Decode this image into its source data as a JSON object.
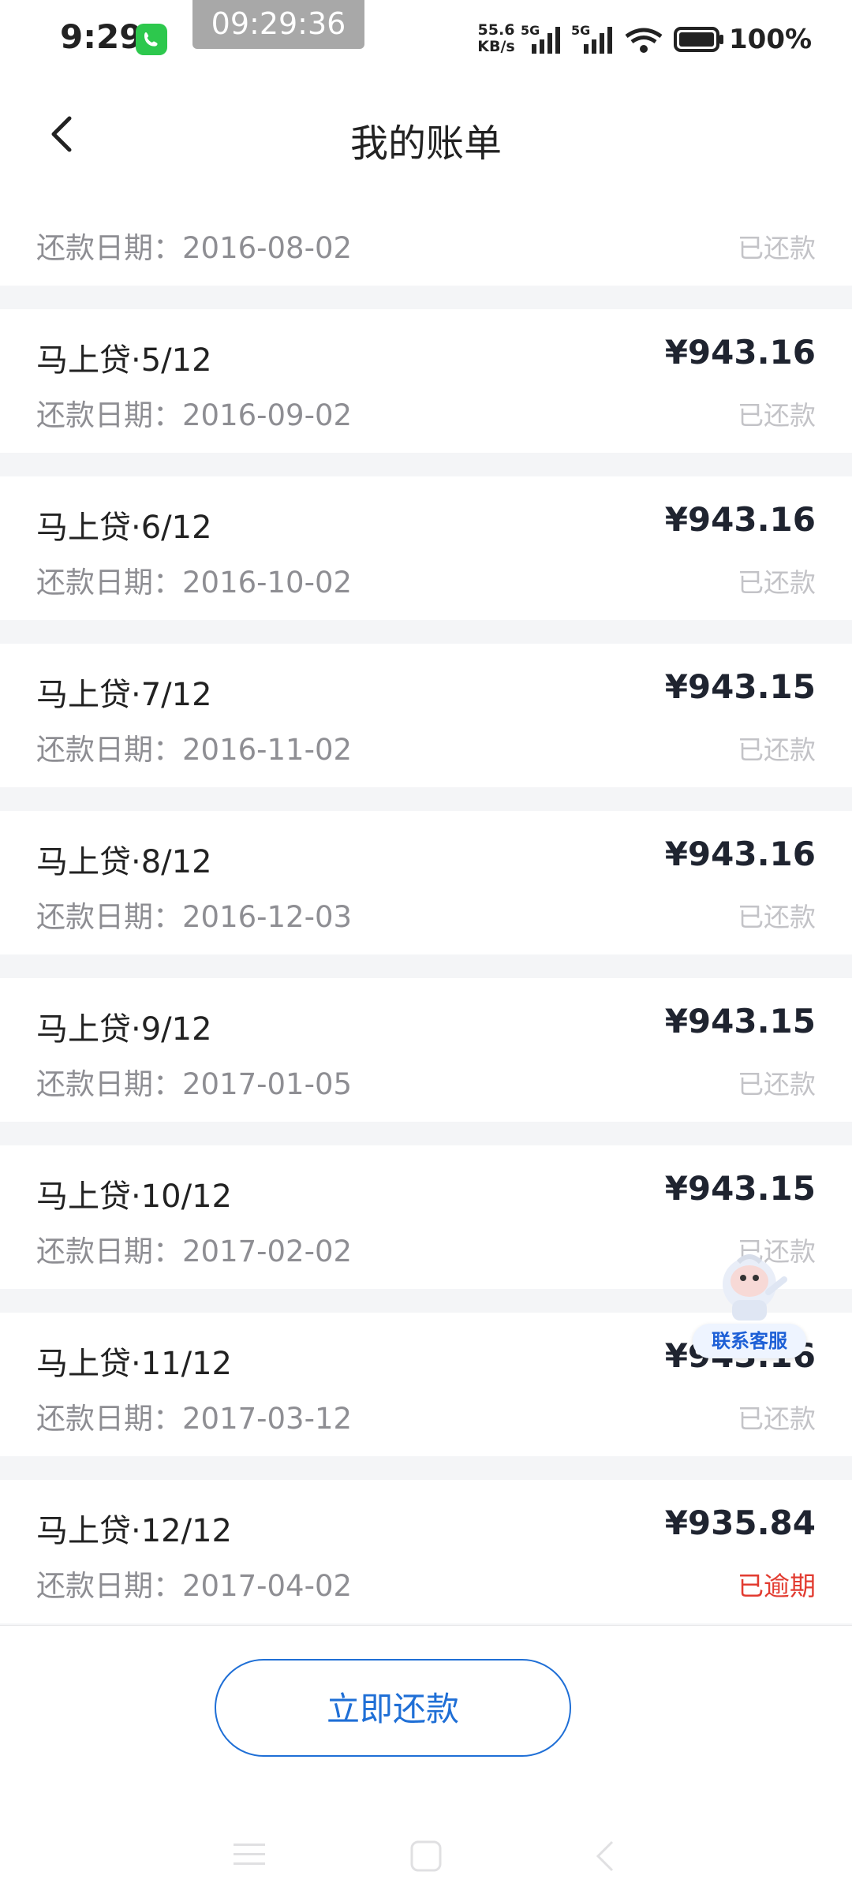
{
  "status_bar": {
    "time": "9:29",
    "clock_overlay": "09:29:36",
    "net_speed_value": "55.6",
    "net_speed_unit": "KB/s",
    "battery": "100%"
  },
  "header": {
    "title": "我的账单"
  },
  "bills": [
    {
      "name": "",
      "date": "还款日期：2016-08-02",
      "amount": "",
      "status": "已还款"
    },
    {
      "name": "马上贷·5/12",
      "date": "还款日期：2016-09-02",
      "amount": "¥943.16",
      "status": "已还款"
    },
    {
      "name": "马上贷·6/12",
      "date": "还款日期：2016-10-02",
      "amount": "¥943.16",
      "status": "已还款"
    },
    {
      "name": "马上贷·7/12",
      "date": "还款日期：2016-11-02",
      "amount": "¥943.15",
      "status": "已还款"
    },
    {
      "name": "马上贷·8/12",
      "date": "还款日期：2016-12-03",
      "amount": "¥943.16",
      "status": "已还款"
    },
    {
      "name": "马上贷·9/12",
      "date": "还款日期：2017-01-05",
      "amount": "¥943.15",
      "status": "已还款"
    },
    {
      "name": "马上贷·10/12",
      "date": "还款日期：2017-02-02",
      "amount": "¥943.15",
      "status": "已还款"
    },
    {
      "name": "马上贷·11/12",
      "date": "还款日期：2017-03-12",
      "amount": "¥943.16",
      "status": "已还款"
    },
    {
      "name": "马上贷·12/12",
      "date": "还款日期：2017-04-02",
      "amount": "¥935.84",
      "status": "已逾期"
    }
  ],
  "service": {
    "label": "联系客服"
  },
  "footer": {
    "pay_label": "立即还款"
  },
  "colors": {
    "accent": "#1f6fd6",
    "overdue": "#e23b30",
    "paid": "#c3c3c7"
  }
}
